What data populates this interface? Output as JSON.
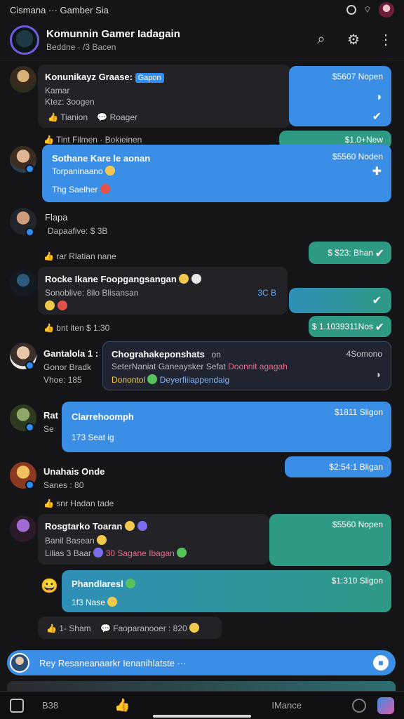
{
  "status_bar": {
    "title": "Cismana ··· Gamber Sia"
  },
  "header": {
    "title": "Komunnin Gamer Iadagain",
    "subtitle": "Beddne · /3 Bacen"
  },
  "messages": {
    "m1": {
      "name": "Konunikayz Graase:",
      "tag": "Gapon",
      "line1": "Kamar",
      "line2": "Ktez: 3oogen",
      "r1": "Tianion",
      "r2": "Roager"
    },
    "m1_out": {
      "time": "$5607 Nopen"
    },
    "r_row1": {
      "text": "Tint Filmen · Bokieinen"
    },
    "m2_out": {
      "time": "$1.0+New"
    },
    "m3": {
      "name": "Sothane Kare le aonan",
      "line1": "Torpaninaano",
      "line2": "Thg Saelher",
      "time": "$5560 Noden"
    },
    "m4": {
      "name": "Flapa",
      "line1": "Dapaafive: $ 3B"
    },
    "r_row2": {
      "text": "rar Rlatian  nane"
    },
    "m4_out": {
      "time": "$ $23: Bhan"
    },
    "m5": {
      "name": "Rocke Ikane Foopgangsangan",
      "line1": "Sonoblive: 8ilo Blisansan",
      "meta": "3C B"
    },
    "r_row3": {
      "text": "bnt iten  $ 1:30"
    },
    "m5_out": {
      "time": "$ 1.1039311Nos"
    },
    "m6": {
      "name": "Gantalola 1 :",
      "line1": "Gonor Bradk",
      "line2": "Vhoe: 185"
    },
    "m6_card": {
      "title": "Chograhakeponshats",
      "title2": "on",
      "time": "4Somono",
      "line1": "SeterNaniat Ganeaysker Sefat",
      "line1b": "Doonnit agagah",
      "line2": "Donontol",
      "line2b": "Deyerfiiiappendaig"
    },
    "m7": {
      "name": "Rat",
      "line1": "Se"
    },
    "m7_out": {
      "title": "Clarrehoomph",
      "time": "$1811 Sligon",
      "line1": "173 Seat ig"
    },
    "m8": {
      "name": "Unahais Onde",
      "line1": "Sanes : 80"
    },
    "m8_out": {
      "time": "$2:54:1 Bligan"
    },
    "r_row4": {
      "text": "snr Hadan  tade"
    },
    "m9": {
      "name": "Rosgtarko Toaran",
      "line1": "Banil Basean",
      "line2": "Lilias 3 Baar",
      "line2b": "30 Sagane Ibagan",
      "time": "$5560 Nopen"
    },
    "m10": {
      "title": "Phandlaresl",
      "time": "$1:310 Sligon",
      "line1": "1f3 Nase"
    },
    "r_row5": {
      "text1": "1-  Sham",
      "text2": "Faoparanooer : 820"
    }
  },
  "input": {
    "placeholder": "Rey Resaneanaarkr Ienanihlatste ···"
  },
  "bottom_nav": {
    "left": "B38",
    "right": "IMance"
  },
  "colors": {
    "accent_blue": "#3a8ee6",
    "accent_green": "#2e9a84",
    "background": "#151517"
  }
}
